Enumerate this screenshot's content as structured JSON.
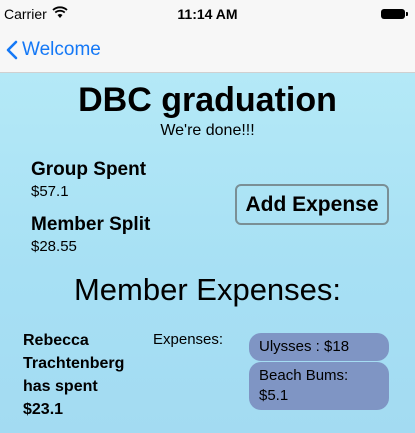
{
  "status": {
    "carrier": "Carrier",
    "time": "11:14 AM"
  },
  "nav": {
    "back_label": "Welcome"
  },
  "group": {
    "title": "DBC graduation",
    "subtitle": "We're done!!!",
    "spent_label": "Group Spent",
    "spent_value": "$57.1",
    "split_label": "Member Split",
    "split_value": "$28.55",
    "add_expense_label": "Add Expense"
  },
  "members_section": {
    "title": "Member Expenses:",
    "members": [
      {
        "name_line1": "Rebecca",
        "name_line2": "Trachtenberg",
        "name_line3": "has spent",
        "amount": "$23.1",
        "expenses_label": "Expenses:",
        "expenses": [
          {
            "text": "Ulysses : $18"
          },
          {
            "line1": "Beach Bums:",
            "line2": "$5.1"
          }
        ]
      }
    ]
  },
  "icons": {
    "wifi": "wifi-icon",
    "battery": "battery-icon",
    "back": "chevron-left-icon"
  },
  "colors": {
    "accent": "#1478f6",
    "bubble": "#7f95c4",
    "background": "#a7e0f4"
  }
}
